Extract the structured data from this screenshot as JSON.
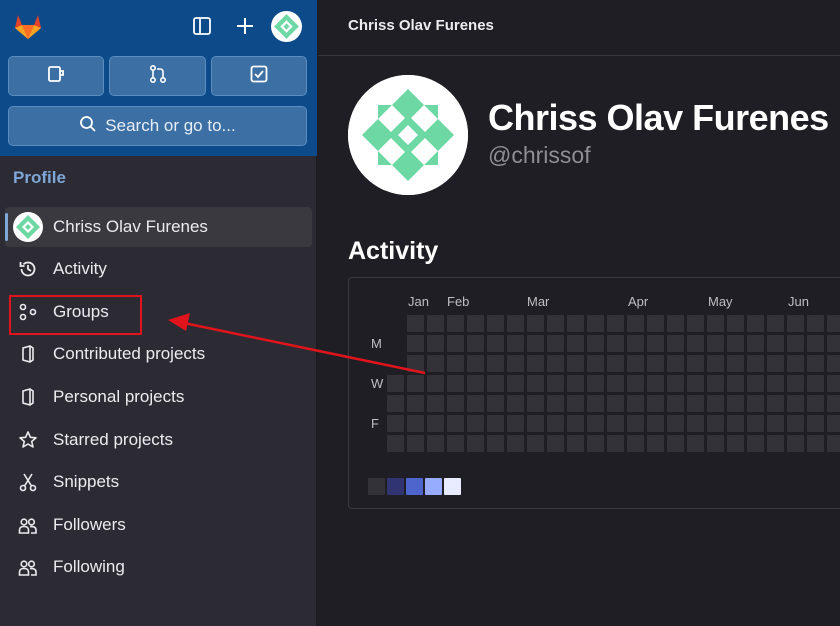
{
  "sidebar": {
    "search": {
      "label": "Search or go to..."
    },
    "section_title": "Profile",
    "items": [
      {
        "label": "Chriss Olav Furenes",
        "icon": "avatar",
        "active": true
      },
      {
        "label": "Activity",
        "icon": "history-icon"
      },
      {
        "label": "Groups",
        "icon": "groups-icon"
      },
      {
        "label": "Contributed projects",
        "icon": "project-icon"
      },
      {
        "label": "Personal projects",
        "icon": "project-icon"
      },
      {
        "label": "Starred projects",
        "icon": "star-icon"
      },
      {
        "label": "Snippets",
        "icon": "snippet-icon"
      },
      {
        "label": "Followers",
        "icon": "users-icon"
      },
      {
        "label": "Following",
        "icon": "users-icon"
      }
    ]
  },
  "main": {
    "breadcrumb": "Chriss Olav Furenes",
    "profile": {
      "name": "Chriss Olav Furenes",
      "handle": "@chrissof"
    },
    "activity": {
      "title": "Activity",
      "months": [
        "Jan",
        "Feb",
        "Mar",
        "Apr",
        "May",
        "Jun"
      ],
      "days": [
        "M",
        "W",
        "F"
      ],
      "legend_colors": [
        "#333238",
        "#303470",
        "#4e65cd",
        "#97acff",
        "#e9ebff"
      ]
    }
  },
  "colors": {
    "sidebar_top": "#0d4a8a",
    "sidebar_bg": "#2c2b33",
    "main_bg": "#1f1e24",
    "annotation": "#e1141c",
    "avatar_green": "#6dd8a4"
  }
}
